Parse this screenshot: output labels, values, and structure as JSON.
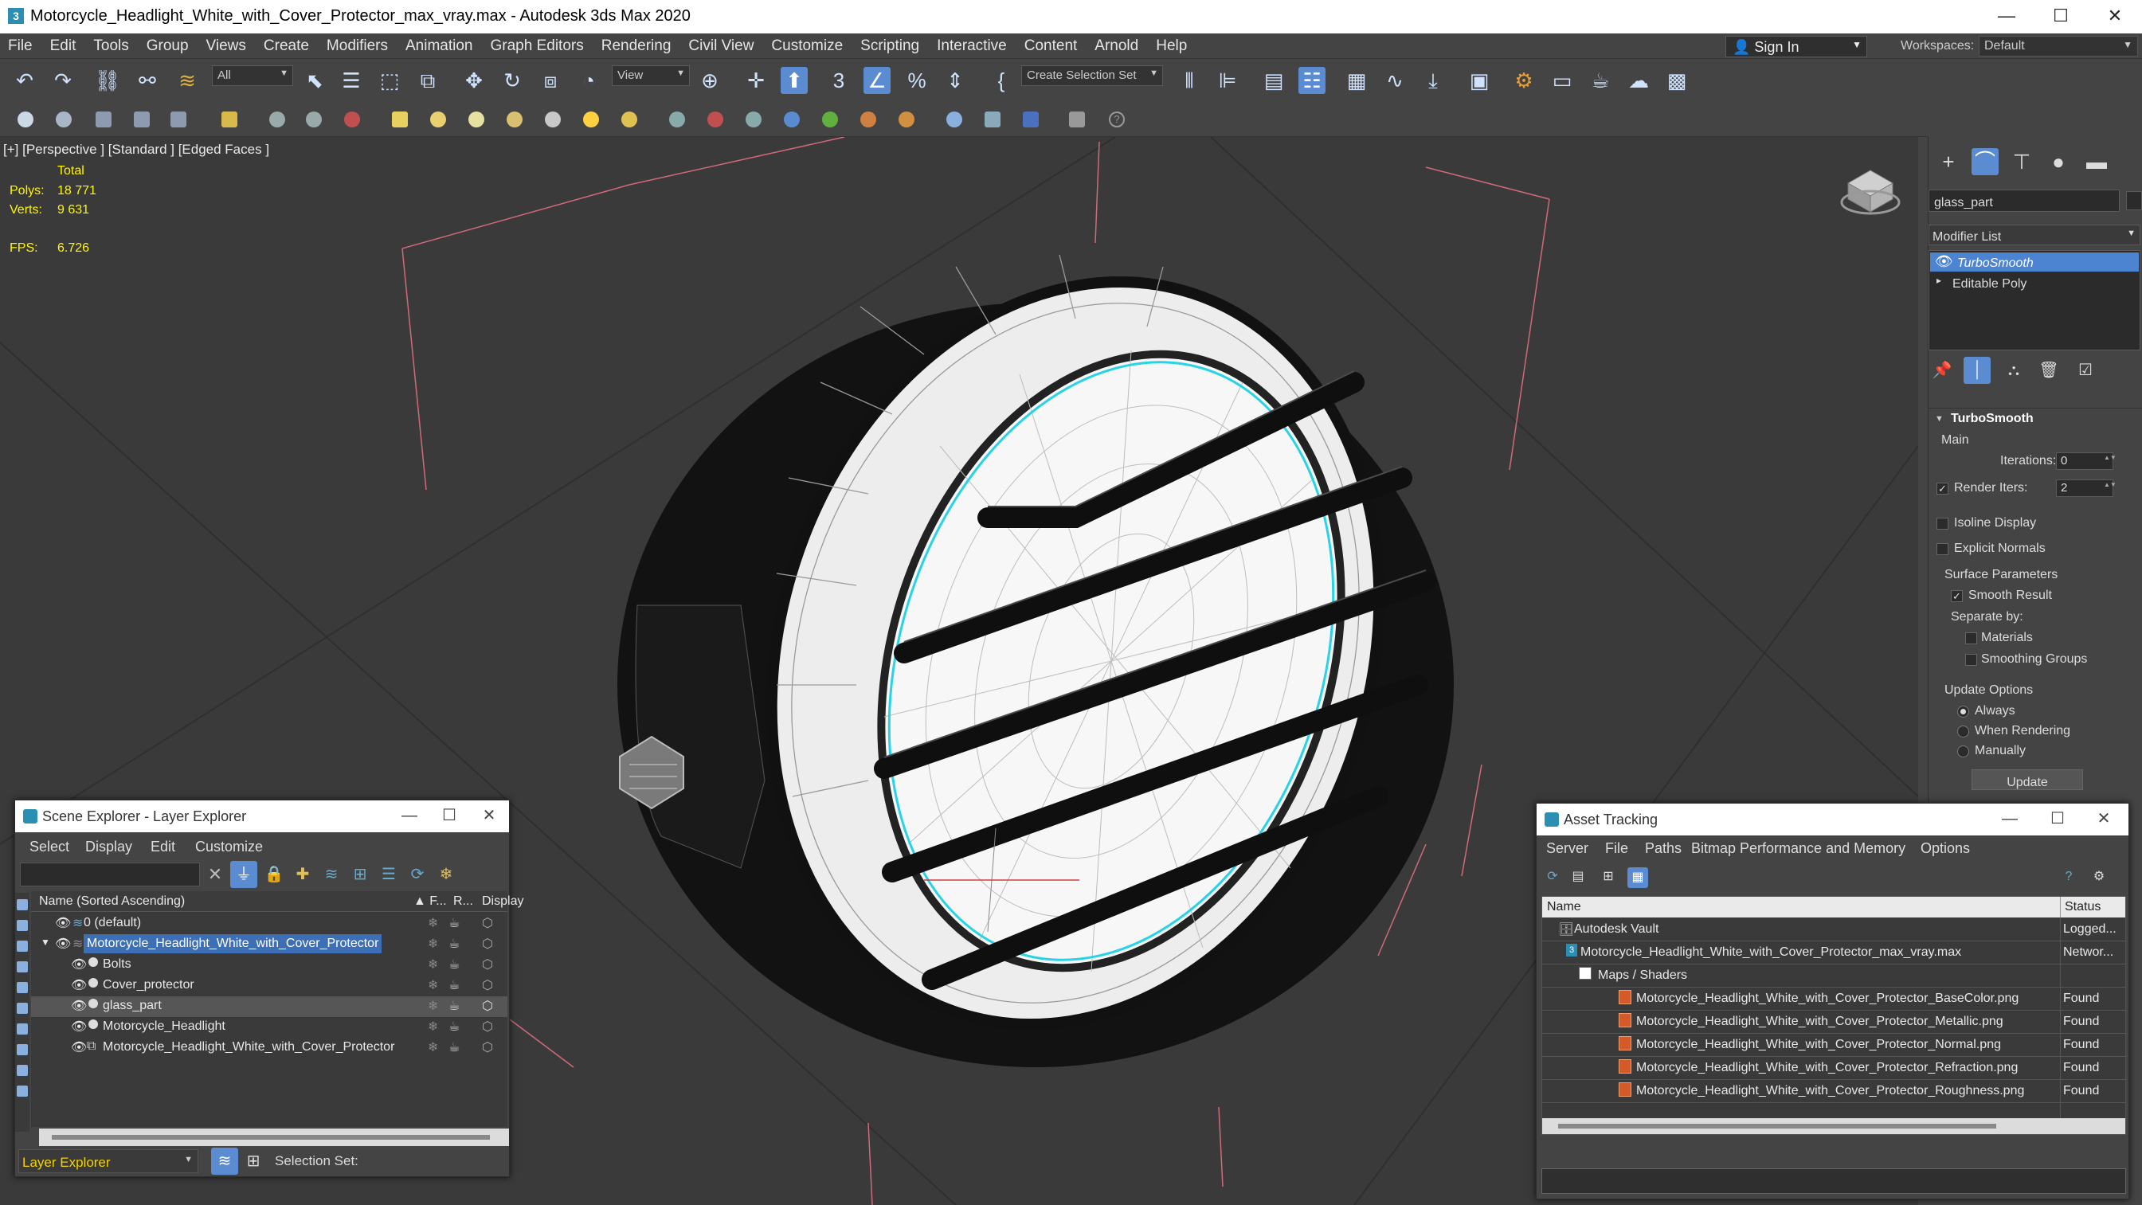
{
  "window": {
    "title": "Motorcycle_Headlight_White_with_Cover_Protector_max_vray.max - Autodesk 3ds Max 2020",
    "minimize": "—",
    "maximize": "☐",
    "close": "✕"
  },
  "menu": [
    "File",
    "Edit",
    "Tools",
    "Group",
    "Views",
    "Create",
    "Modifiers",
    "Animation",
    "Graph Editors",
    "Rendering",
    "Civil View",
    "Customize",
    "Scripting",
    "Interactive",
    "Content",
    "Arnold",
    "Help"
  ],
  "account": {
    "sign_in": "Sign In",
    "workspaces_label": "Workspaces:",
    "workspace": "Default"
  },
  "toolbar": {
    "selection_filter": "All",
    "reference_coord": "View",
    "named_selection": "Create Selection Set",
    "snap_label": "3",
    "angle_snap": "%"
  },
  "viewport": {
    "label": "[+] [Perspective ] [Standard ] [Edged Faces ]",
    "stats_header": "Total",
    "polys_label": "Polys:",
    "polys_value": "18 771",
    "verts_label": "Verts:",
    "verts_value": "9 631",
    "fps_label": "FPS:",
    "fps_value": "6.726"
  },
  "command_panel": {
    "object_name": "glass_part",
    "modifier_list": "Modifier List",
    "stack": [
      "TurboSmooth",
      "Editable Poly"
    ],
    "rollout": "TurboSmooth",
    "main": "Main",
    "iterations_label": "Iterations:",
    "iterations": "0",
    "render_iters_label": "Render Iters:",
    "render_iters": "2",
    "isoline": "Isoline Display",
    "explicit_normals": "Explicit Normals",
    "surface_params": "Surface Parameters",
    "smooth_result": "Smooth Result",
    "separate_by": "Separate by:",
    "materials": "Materials",
    "smoothing_groups": "Smoothing Groups",
    "update_options": "Update Options",
    "always": "Always",
    "when_rendering": "When Rendering",
    "manually": "Manually",
    "update": "Update"
  },
  "scene_explorer": {
    "title": "Scene Explorer - Layer Explorer",
    "menu": [
      "Select",
      "Display",
      "Edit",
      "Customize"
    ],
    "columns": {
      "name": "Name (Sorted Ascending)",
      "f": "▲ F...",
      "r": "R...",
      "display": "Display"
    },
    "rows": [
      {
        "label": "0 (default)",
        "indent": 0,
        "selected": false
      },
      {
        "label": "Motorcycle_Headlight_White_with_Cover_Protector",
        "indent": 0,
        "selected": true
      },
      {
        "label": "Bolts",
        "indent": 1,
        "selected": false
      },
      {
        "label": "Cover_protector",
        "indent": 1,
        "selected": false
      },
      {
        "label": "glass_part",
        "indent": 1,
        "selected": false
      },
      {
        "label": "Motorcycle_Headlight",
        "indent": 1,
        "selected": false
      },
      {
        "label": "Motorcycle_Headlight_White_with_Cover_Protector",
        "indent": 1,
        "selected": false
      }
    ],
    "footer_layer": "Layer Explorer",
    "footer_selection": "Selection Set:"
  },
  "asset_tracking": {
    "title": "Asset Tracking",
    "menu": [
      "Server",
      "File",
      "Paths",
      "Bitmap Performance and Memory",
      "Options"
    ],
    "columns": {
      "name": "Name",
      "status": "Status"
    },
    "rows": [
      {
        "name": "Autodesk Vault",
        "status": "Logged...",
        "indent": 0
      },
      {
        "name": "Motorcycle_Headlight_White_with_Cover_Protector_max_vray.max",
        "status": "Networ...",
        "indent": 1
      },
      {
        "name": "Maps / Shaders",
        "status": "",
        "indent": 2
      },
      {
        "name": "Motorcycle_Headlight_White_with_Cover_Protector_BaseColor.png",
        "status": "Found",
        "indent": 3
      },
      {
        "name": "Motorcycle_Headlight_White_with_Cover_Protector_Metallic.png",
        "status": "Found",
        "indent": 3
      },
      {
        "name": "Motorcycle_Headlight_White_with_Cover_Protector_Normal.png",
        "status": "Found",
        "indent": 3
      },
      {
        "name": "Motorcycle_Headlight_White_with_Cover_Protector_Refraction.png",
        "status": "Found",
        "indent": 3
      },
      {
        "name": "Motorcycle_Headlight_White_with_Cover_Protector_Roughness.png",
        "status": "Found",
        "indent": 3
      }
    ]
  },
  "colors": {
    "accent": "#5b8bd0",
    "selection": "#3d6fb7",
    "stats": "#fff600",
    "cyan_spline": "#27d3e6"
  }
}
